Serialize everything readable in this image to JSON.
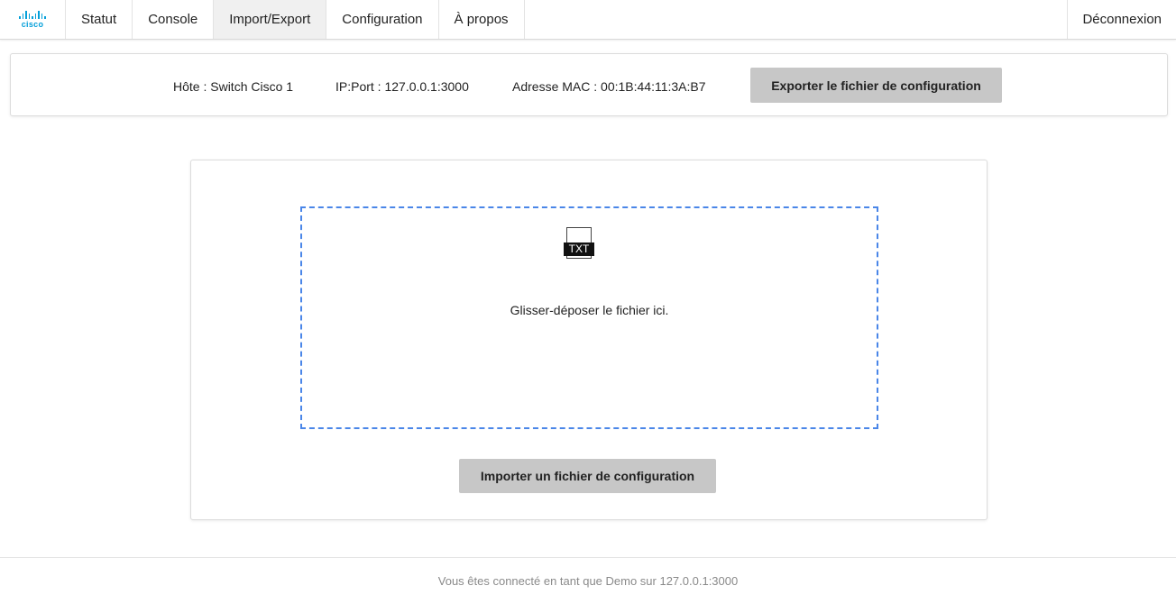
{
  "brand": {
    "logo_text": "cisco",
    "logo_color": "#049fd9"
  },
  "nav": {
    "items": [
      {
        "label": "Statut",
        "active": false
      },
      {
        "label": "Console",
        "active": false
      },
      {
        "label": "Import/Export",
        "active": true
      },
      {
        "label": "Configuration",
        "active": false
      },
      {
        "label": "À propos",
        "active": false
      }
    ],
    "logout_label": "Déconnexion"
  },
  "info": {
    "host": "Hôte : Switch Cisco 1",
    "ip_port": "IP:Port : 127.0.0.1:3000",
    "mac": "Adresse MAC : 00:1B:44:11:3A:B7",
    "export_label": "Exporter le fichier de configuration"
  },
  "import": {
    "file_icon_label": "TXT",
    "drop_text": "Glisser-déposer le fichier ici.",
    "import_label": "Importer un fichier de configuration",
    "dropzone_border_color": "#4a86e8",
    "button_color": "#c7c7c7"
  },
  "footer": {
    "text": "Vous êtes connecté en tant que Demo sur 127.0.0.1:3000"
  }
}
